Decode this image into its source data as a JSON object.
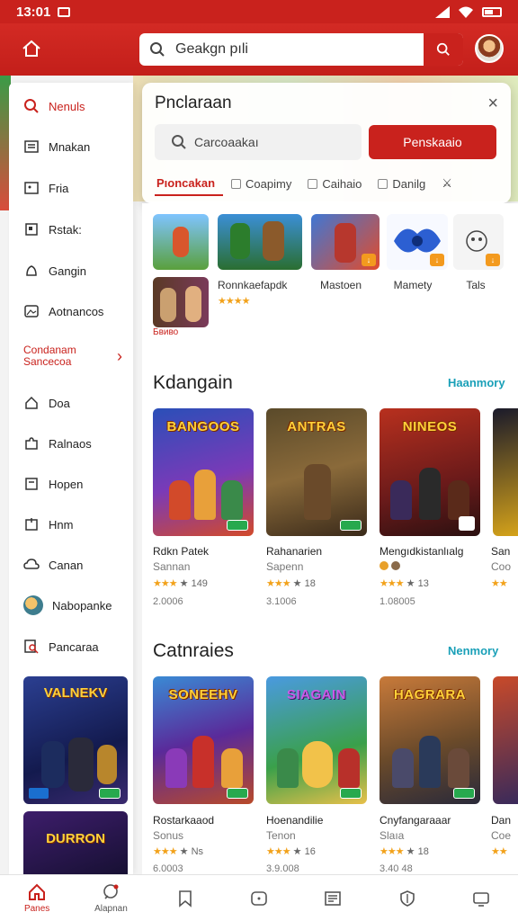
{
  "status": {
    "time": "13:01"
  },
  "header": {
    "search_value": "Geakgn pıli"
  },
  "sidebar": {
    "items": [
      {
        "label": "Nenuls",
        "icon": "search-icon"
      },
      {
        "label": "Mnakan",
        "icon": "list-icon"
      },
      {
        "label": "Fria",
        "icon": "photo-icon"
      },
      {
        "label": "Rstak:",
        "icon": "square-icon"
      },
      {
        "label": "Gangin",
        "icon": "bell-icon"
      },
      {
        "label": "Aotnancos",
        "icon": "image-icon"
      },
      {
        "label": "Condanam Sancecoa"
      },
      {
        "label": "Doa",
        "icon": "home-icon"
      },
      {
        "label": "Ralnaos",
        "icon": "puzzle-icon"
      },
      {
        "label": "Hopen",
        "icon": "doc-icon"
      },
      {
        "label": "Hnm",
        "icon": "tag-icon"
      },
      {
        "label": "Canan",
        "icon": "cloud-icon"
      },
      {
        "label": "Nabopanke",
        "icon": "avatar"
      },
      {
        "label": "Pancaraa",
        "icon": "search-doc-icon"
      }
    ]
  },
  "panel": {
    "title": "Pnclaraan",
    "input_placeholder": "Carcoaakaı",
    "button_label": "Penskaaio",
    "tabs": [
      {
        "label": "Pıoncakan"
      },
      {
        "label": "Coapimy"
      },
      {
        "label": "Caihaio"
      },
      {
        "label": "Danilg"
      }
    ]
  },
  "strip": {
    "labels": [
      "Ronnkaefapdk",
      "Mastoen",
      "Mamety",
      "Tals"
    ],
    "rating": "★★★★",
    "tag": "Бвиво"
  },
  "section1": {
    "title": "Kdangain",
    "link": "Haanmory",
    "cards": [
      {
        "art_title": "BANGOOS",
        "name": "Rdkn Patek",
        "sub": "Sannan",
        "stars": "★★★",
        "rating": "★ 149",
        "count": "2.0006"
      },
      {
        "art_title": "ANTRAS",
        "name": "Rahanarien",
        "sub": "Sapenn",
        "stars": "★★★",
        "rating": "★ 18",
        "count": "3.1006"
      },
      {
        "art_title": "NINEOS",
        "name": "Mengıdkistanlıalg",
        "sub": "",
        "stars": "★★★",
        "rating": "★ 13",
        "count": "1.08005"
      },
      {
        "name": "San",
        "sub": "Coo",
        "stars": "★★",
        "count": ""
      }
    ]
  },
  "section2": {
    "title": "Catnraies",
    "link": "Nenmory",
    "cards": [
      {
        "art_title": "SONEEHV",
        "name": "Rostarkaaod",
        "sub": "Sonus",
        "stars": "★★★",
        "rating": "★ Ns",
        "count": "6.0003"
      },
      {
        "art_title": "SIAGAIN",
        "name": "Hoenandilie",
        "sub": "Tenon",
        "stars": "★★★",
        "rating": "★ 16",
        "count": "3.9.008"
      },
      {
        "art_title": "HAGRARA",
        "name": "Cnyfangaraaar",
        "sub": "Slaıa",
        "stars": "★★★",
        "rating": "★ 18",
        "count": "3.40 48"
      },
      {
        "name": "Dan",
        "sub": "Coe",
        "stars": "★★",
        "count": ""
      }
    ]
  },
  "sidebar_cards": [
    {
      "art_title": "VALNEKV"
    },
    {
      "art_title": "DURRON"
    }
  ],
  "bottom_nav": [
    {
      "label": "Panes",
      "icon": "home-icon"
    },
    {
      "label": "Alapnan",
      "icon": "chat-icon"
    },
    {
      "label": "",
      "icon": "bookmark-icon"
    },
    {
      "label": "",
      "icon": "gamepad-icon"
    },
    {
      "label": "",
      "icon": "news-icon"
    },
    {
      "label": "",
      "icon": "shield-icon"
    },
    {
      "label": "",
      "icon": "tv-icon"
    }
  ]
}
